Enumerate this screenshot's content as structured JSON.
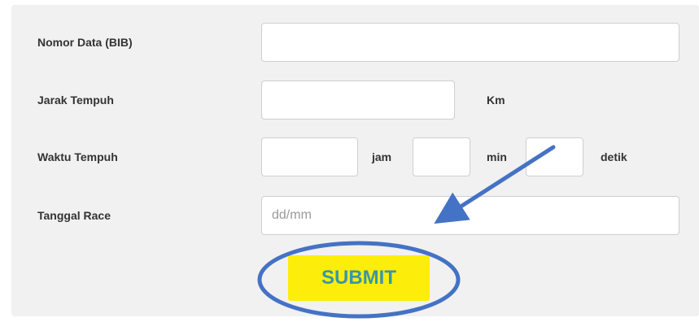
{
  "form": {
    "bib": {
      "label": "Nomor Data (BIB)",
      "value": ""
    },
    "distance": {
      "label": "Jarak Tempuh",
      "value": "",
      "unit": "Km"
    },
    "time": {
      "label": "Waktu Tempuh",
      "hours_value": "",
      "hours_unit": "jam",
      "minutes_value": "",
      "minutes_unit": "min",
      "seconds_value": "",
      "seconds_unit": "detik"
    },
    "race_date": {
      "label": "Tanggal Race",
      "value": "",
      "placeholder": "dd/mm"
    },
    "submit_label": "SUBMIT"
  },
  "annotation": {
    "color": "#4472c4"
  },
  "colors": {
    "submit_bg": "#fcee0a",
    "submit_text": "#3a96a8",
    "panel_bg": "#f1f1f1"
  }
}
